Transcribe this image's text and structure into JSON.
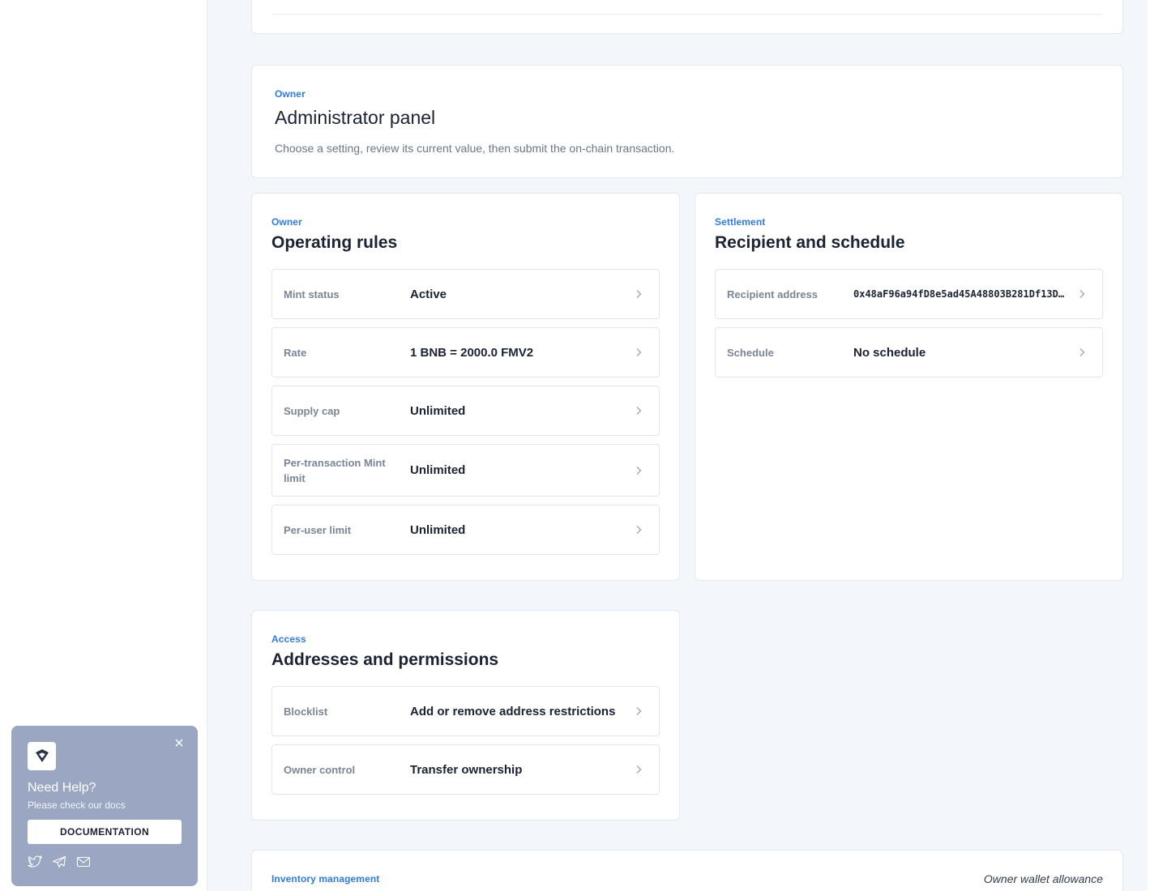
{
  "admin_panel": {
    "eyebrow": "Owner",
    "title": "Administrator panel",
    "description": "Choose a setting, review its current value, then submit the on-chain transaction."
  },
  "operating_rules": {
    "eyebrow": "Owner",
    "title": "Operating rules",
    "rows": [
      {
        "label": "Mint status",
        "value": "Active"
      },
      {
        "label": "Rate",
        "value": "1 BNB = 2000.0 FMV2"
      },
      {
        "label": "Supply cap",
        "value": "Unlimited"
      },
      {
        "label": "Per-transaction Mint limit",
        "value": "Unlimited"
      },
      {
        "label": "Per-user limit",
        "value": "Unlimited"
      }
    ]
  },
  "settlement": {
    "eyebrow": "Settlement",
    "title": "Recipient and schedule",
    "rows": [
      {
        "label": "Recipient address",
        "value": "0x48aF96a94fD8e5ad45A48803B281Df13D…"
      },
      {
        "label": "Schedule",
        "value": "No schedule"
      }
    ]
  },
  "access": {
    "eyebrow": "Access",
    "title": "Addresses and permissions",
    "rows": [
      {
        "label": "Blocklist",
        "value": "Add or remove address restrictions"
      },
      {
        "label": "Owner control",
        "value": "Transfer ownership"
      }
    ]
  },
  "inventory": {
    "eyebrow": "Inventory management",
    "aside": "Owner wallet allowance"
  },
  "help_widget": {
    "title": "Need Help?",
    "subtitle": "Please check our docs",
    "button_label": "DOCUMENTATION",
    "icons": [
      "diamond-logo-icon",
      "close-icon",
      "twitter-icon",
      "telegram-icon",
      "mail-icon"
    ]
  },
  "colors": {
    "accent": "#2f7be0",
    "page_background": "#f3f6fb",
    "help_background": "#9aa6c2"
  }
}
